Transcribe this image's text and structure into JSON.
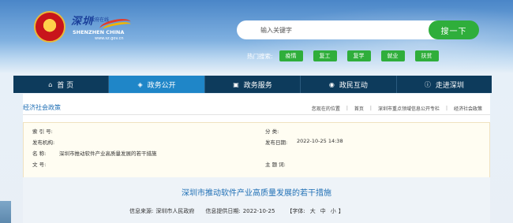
{
  "header": {
    "logo_cn": "深圳",
    "logo_cn_sub": "政府在线",
    "logo_en": "SHENZHEN CHINA",
    "logo_url": "www.sz.gov.cn",
    "emblem_icon": "national-emblem-icon"
  },
  "search": {
    "placeholder": "输入关键字",
    "button_label": "搜一下"
  },
  "hot_search": {
    "label": "热门搜索:",
    "tags": [
      "疫情",
      "复工",
      "复学",
      "就业",
      "扶贫"
    ]
  },
  "nav": {
    "items": [
      {
        "label": "首 页",
        "icon": "home-icon"
      },
      {
        "label": "政务公开",
        "icon": "shield-icon"
      },
      {
        "label": "政务服务",
        "icon": "monitor-icon"
      },
      {
        "label": "政民互动",
        "icon": "chat-icon"
      },
      {
        "label": "走进深圳",
        "icon": "info-icon"
      }
    ]
  },
  "breadcrumb": {
    "title": "经济社会政策",
    "location_label": "您现在的位置",
    "path": [
      "首页",
      "深圳市重点领域信息公开专栏",
      "经济社会政策"
    ]
  },
  "meta": {
    "index_label": "索 引 号:",
    "index_value": "",
    "category_label": "分    类:",
    "category_value": "",
    "publisher_label": "发布机构:",
    "publisher_value": "",
    "date_label": "发布日期:",
    "date_value": "2022-10-25 14:38",
    "name_label": "名    称:",
    "name_value": "深圳市推动软件产业高质量发展的若干措施",
    "docno_label": "文    号:",
    "docno_value": "",
    "keywords_label": "主 题 词:",
    "keywords_value": ""
  },
  "article": {
    "title": "深圳市推动软件产业高质量发展的若干措施",
    "source_label": "信息来源:",
    "source_value": "深圳市人民政府",
    "provide_date_label": "信息提供日期:",
    "provide_date_value": "2022-10-25",
    "font_label": "【字体:",
    "font_large": "大",
    "font_medium": "中",
    "font_small": "小",
    "font_close": "】"
  },
  "colors": {
    "nav_bg": "#0d3b5c",
    "nav_active": "#1f86c8",
    "accent_green": "#2fae3b",
    "link_blue": "#1f6fb5"
  }
}
